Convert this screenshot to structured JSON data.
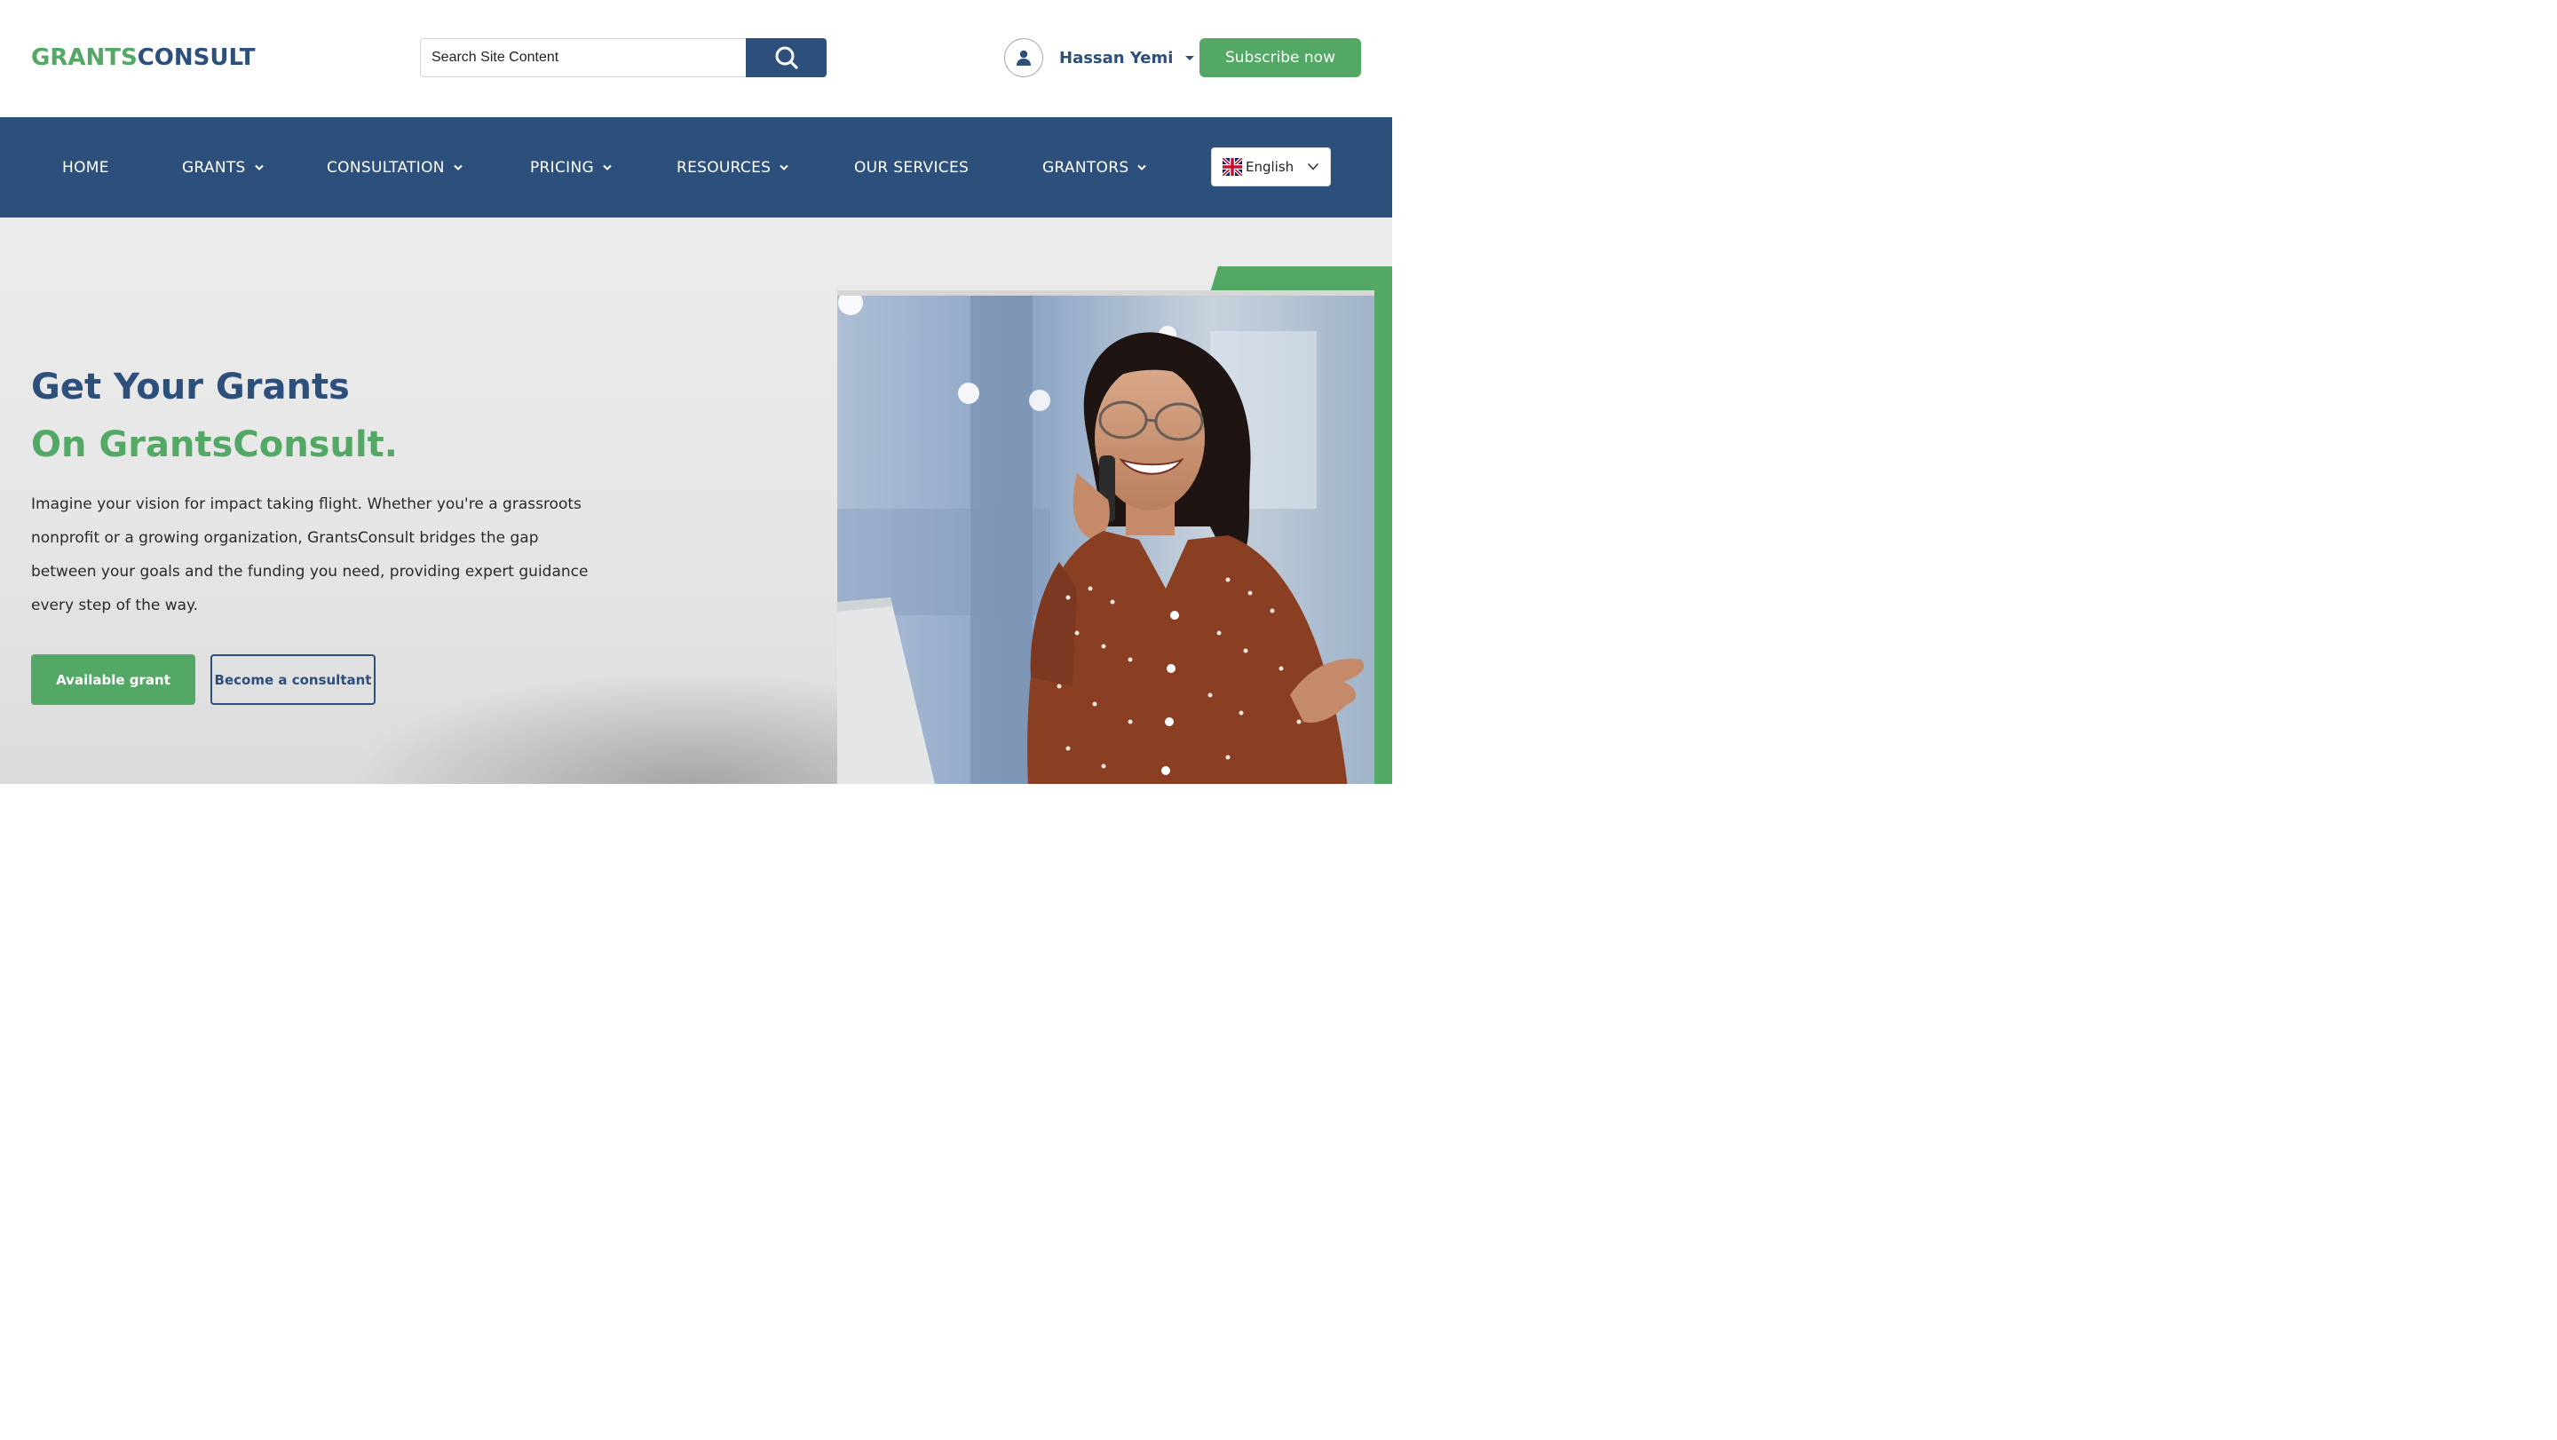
{
  "header": {
    "logo_part1": "GRANTS",
    "logo_part2": "CONSULT",
    "search_placeholder": "Search Site Content",
    "user_name": "Hassan Yemi",
    "subscribe_label": "Subscribe now"
  },
  "nav": {
    "items": [
      {
        "label": "HOME"
      },
      {
        "label": "GRANTS"
      },
      {
        "label": "CONSULTATION"
      },
      {
        "label": "PRICING"
      },
      {
        "label": "RESOURCES"
      },
      {
        "label": "OUR SERVICES"
      },
      {
        "label": "GRANTORS"
      }
    ],
    "language": "English"
  },
  "hero": {
    "title_line1": "Get Your Grants",
    "title_line2": "On GrantsConsult.",
    "description": "Imagine your vision for impact taking flight. Whether you're a grassroots nonprofit or a growing organization, GrantsConsult bridges the gap between your goals and the funding you need, providing expert guidance every step of the way.",
    "primary_button": "Available grant",
    "secondary_button": "Become a consultant"
  },
  "colors": {
    "brand_blue": "#2c4f7c",
    "brand_green": "#52a864"
  }
}
